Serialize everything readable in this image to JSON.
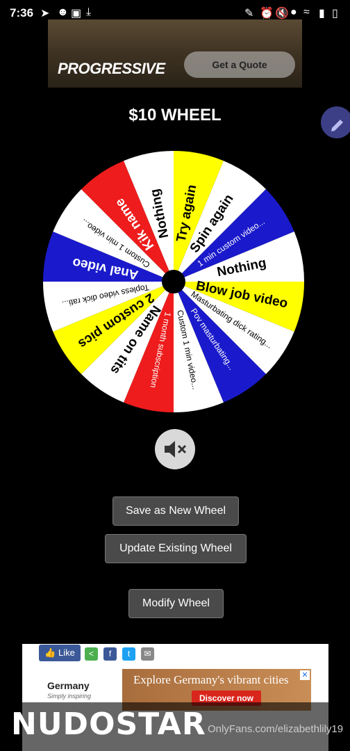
{
  "status_bar": {
    "time": "7:36",
    "left_icons": [
      "telegram-icon",
      "incognito-icon",
      "image-icon",
      "download-icon"
    ],
    "right_icons": [
      "edit-icon",
      "alarm-icon",
      "mute-icon",
      "location-icon",
      "wifi-icon",
      "signal-icon",
      "battery-icon"
    ]
  },
  "ad_top": {
    "brand": "PROGRESSIVE",
    "cta": "Get a Quote"
  },
  "wheel": {
    "title": "$10 WHEEL",
    "segments": [
      {
        "label": "Try again",
        "color": "#ffff00"
      },
      {
        "label": "Spin again",
        "color": "#ffffff"
      },
      {
        "label": "1 min custom video...",
        "color": "#1a1acc"
      },
      {
        "label": "Nothing",
        "color": "#ffffff"
      },
      {
        "label": "Blow job video",
        "color": "#ffff00"
      },
      {
        "label": "Masturbating dick rating...",
        "color": "#ffffff"
      },
      {
        "label": "Pov masturbating...",
        "color": "#1a1acc"
      },
      {
        "label": "Custom 1 min video...",
        "color": "#ffffff"
      },
      {
        "label": "1 month subscription",
        "color": "#ee1c1c"
      },
      {
        "label": "Name on tits",
        "color": "#ffffff"
      },
      {
        "label": "2 custom pics",
        "color": "#ffff00"
      },
      {
        "label": "Topless video dick rati...",
        "color": "#ffffff"
      },
      {
        "label": "Anal video",
        "color": "#1a1acc"
      },
      {
        "label": "Custom 1 min video...",
        "color": "#ffffff"
      },
      {
        "label": "Kik name",
        "color": "#ee1c1c"
      },
      {
        "label": "Nothing",
        "color": "#ffffff"
      }
    ]
  },
  "controls": {
    "mute_icon": "speaker-muted-icon",
    "save_label": "Save as New Wheel",
    "update_label": "Update Existing Wheel",
    "modify_label": "Modify Wheel"
  },
  "share": {
    "like_label": "Like",
    "icons": [
      "share-icon",
      "facebook-icon",
      "twitter-icon",
      "email-icon"
    ]
  },
  "ad_bottom": {
    "logo_title": "Germany",
    "logo_sub": "Simply inspiring",
    "headline": "Explore Germany's vibrant cities",
    "cta": "Discover now"
  },
  "watermark": {
    "brand": "NUDOSTAR",
    "url": "OnlyFans.com/elizabethlily19"
  }
}
